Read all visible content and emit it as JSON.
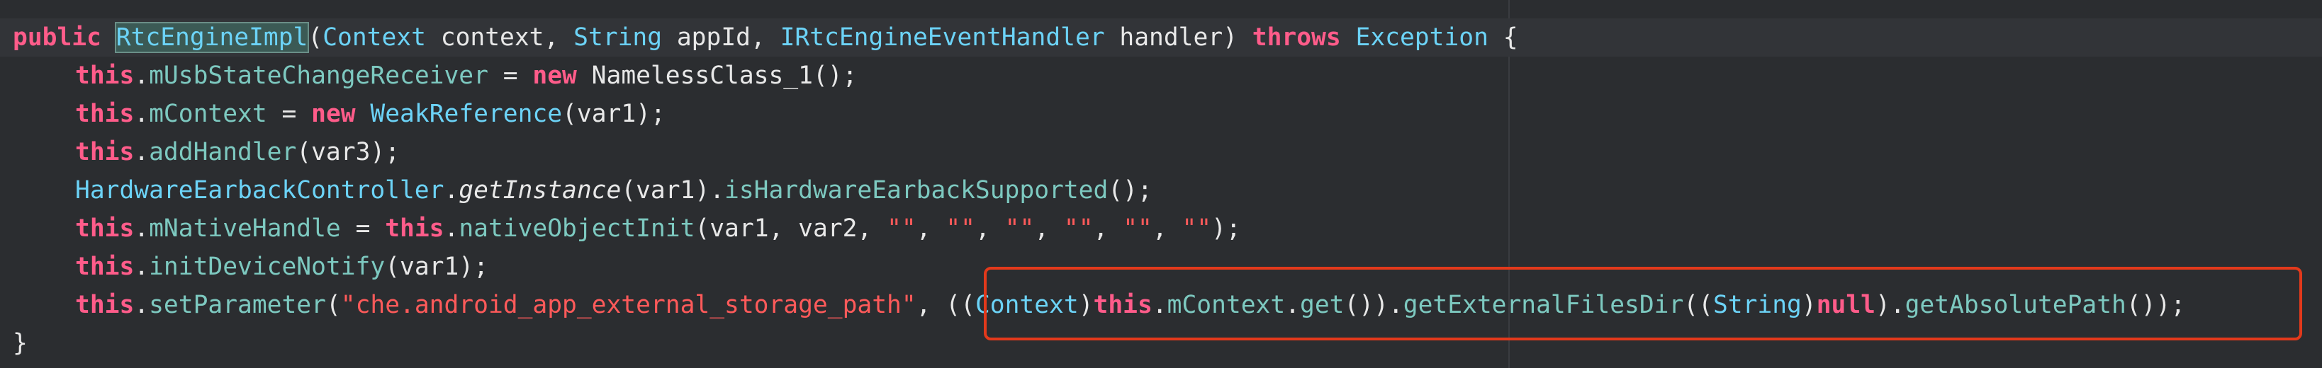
{
  "code": {
    "l1": {
      "kw_public": "public ",
      "class_name": "RtcEngineImpl",
      "p1": "(",
      "t_context": "Context",
      "p2": " context, ",
      "t_string": "String",
      "p3": " appId, ",
      "t_handler": "IRtcEngineEventHandler",
      "p4": " handler) ",
      "kw_throws": "throws",
      "p5": " ",
      "t_exception": "Exception",
      "p6": " {"
    },
    "l2": {
      "kw_this": "this",
      "dot": ".",
      "field": "mUsbStateChangeReceiver",
      "eq": " = ",
      "kw_new": "new",
      "rest": " NamelessClass_1();"
    },
    "l3": {
      "kw_this": "this",
      "dot": ".",
      "field": "mContext",
      "eq": " = ",
      "kw_new": "new",
      "sp": " ",
      "type": "WeakReference",
      "rest": "(var1);"
    },
    "l4": {
      "kw_this": "this",
      "dot": ".",
      "method": "addHandler",
      "rest": "(var3);"
    },
    "l5": {
      "type": "HardwareEarbackController",
      "dot": ".",
      "method": "getInstance",
      "p1": "(var1).",
      "method2": "isHardwareEarbackSupported",
      "rest": "();"
    },
    "l6": {
      "kw_this": "this",
      "dot": ".",
      "field": "mNativeHandle",
      "eq": " = ",
      "kw_this2": "this",
      "dot2": ".",
      "method": "nativeObjectInit",
      "p1": "(var1, var2, ",
      "s1": "\"\"",
      "c1": ", ",
      "s2": "\"\"",
      "c2": ", ",
      "s3": "\"\"",
      "c3": ", ",
      "s4": "\"\"",
      "c4": ", ",
      "s5": "\"\"",
      "c5": ", ",
      "s6": "\"\"",
      "rest": ");"
    },
    "l7": {
      "kw_this": "this",
      "dot": ".",
      "method": "initDeviceNotify",
      "rest": "(var1);"
    },
    "l8": {
      "kw_this": "this",
      "dot": ".",
      "method": "setParameter",
      "p1": "(",
      "str": "\"che.android_app_external_storage_path\"",
      "p2": ", ((",
      "t_context": "Context",
      "p3": ")",
      "dot2": ".",
      "field": "mContext",
      "dot3": ".",
      "m_get": "get",
      "p4": "()).",
      "m_files": "getExternalFilesDir",
      "p5": "((",
      "t_string": "String",
      "p6": ")",
      "kw_null": "null",
      "p7": ").",
      "m_abs": "getAbsolutePath",
      "p8": "());"
    },
    "l9": {
      "brace": "}"
    }
  },
  "colors": {
    "background": "#2b2d30",
    "keyword": "#ff5c8a",
    "type": "#6cd3f7",
    "member": "#7dc9c0",
    "string": "#ff5a5a",
    "plain": "#e8e8e8",
    "annotation_box": "#e3391b"
  }
}
